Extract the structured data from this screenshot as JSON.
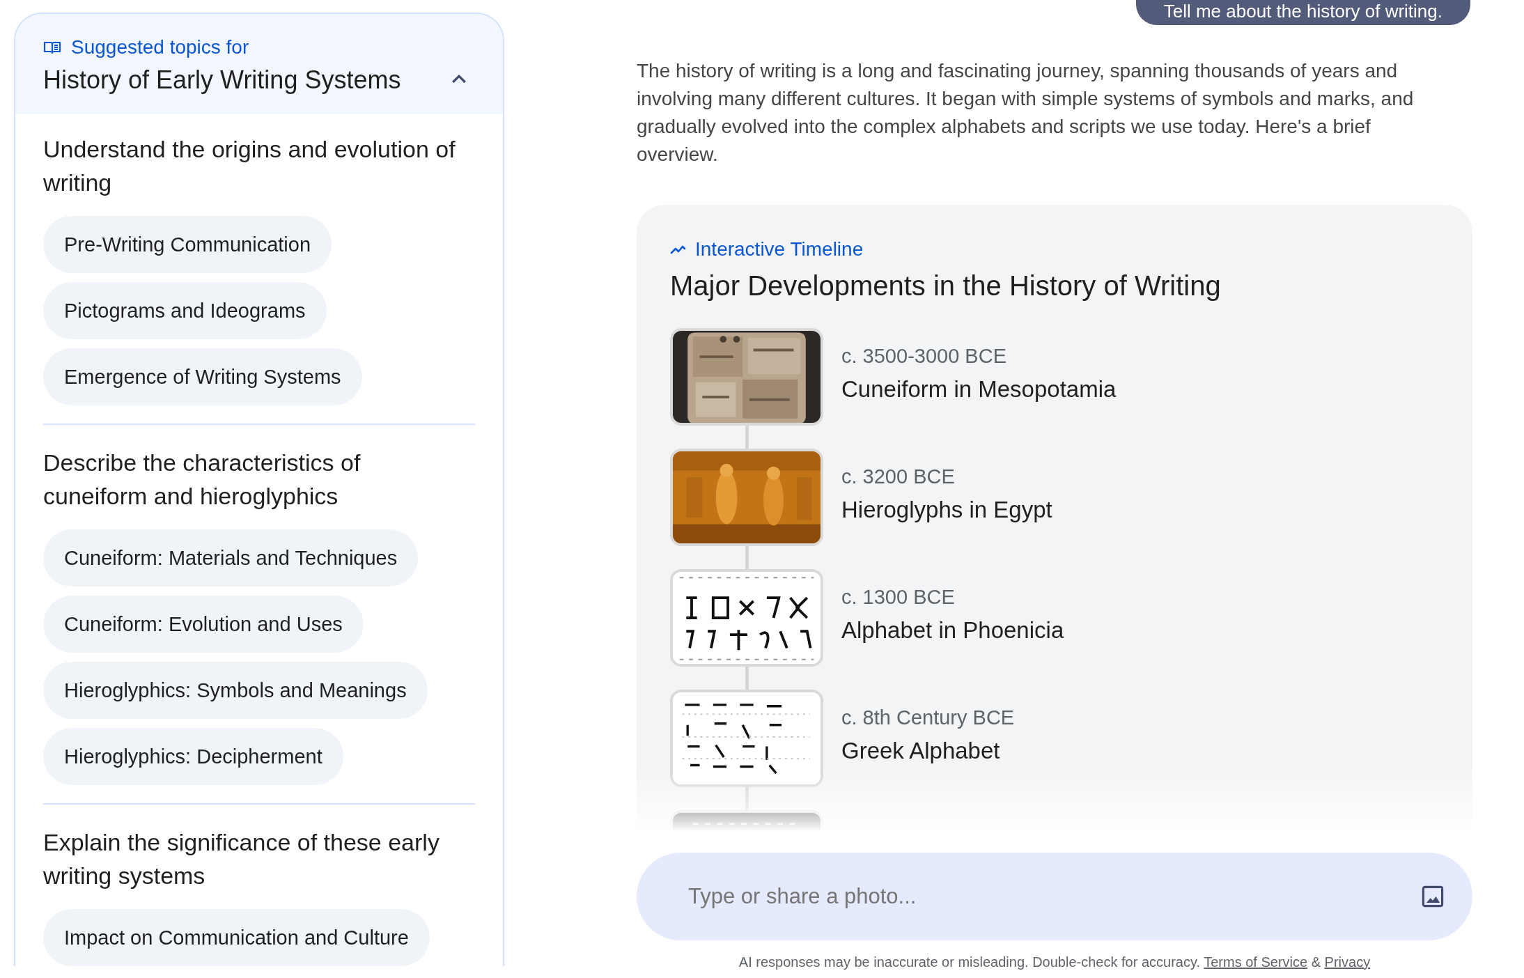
{
  "user_message": "Tell me about the history of writing.",
  "topics_panel": {
    "label": "Suggested topics for",
    "title": "History of Early Writing Systems",
    "expanded": true,
    "sections": [
      {
        "heading": "Understand the origins and evolution of writing",
        "topics": [
          "Pre-Writing Communication",
          "Pictograms and Ideograms",
          "Emergence of Writing Systems"
        ]
      },
      {
        "heading": "Describe the characteristics of cuneiform and hieroglyphics",
        "topics": [
          "Cuneiform: Materials and Techniques",
          "Cuneiform: Evolution and Uses",
          "Hieroglyphics: Symbols and Meanings",
          "Hieroglyphics: Decipherment"
        ]
      },
      {
        "heading": "Explain the significance of these early writing systems",
        "topics": [
          "Impact on Communication and Culture"
        ]
      }
    ]
  },
  "response": {
    "intro": "The history of writing is a long and fascinating journey, spanning thousands of years and involving many different cultures. It began with simple systems of symbols and marks, and gradually evolved into the complex alphabets and scripts we use today. Here's a brief overview.",
    "timeline": {
      "label": "Interactive Timeline",
      "title": "Major Developments in the History of Writing",
      "events": [
        {
          "date": "c. 3500-3000 BCE",
          "title": "Cuneiform in Mesopotamia",
          "image": {
            "kind": "picture"
          }
        },
        {
          "date": "c. 3200 BCE",
          "title": "Hieroglyphs in Egypt",
          "image": {
            "kind": "picture"
          }
        },
        {
          "date": "c. 1300 BCE",
          "title": "Alphabet in Phoenicia",
          "image": {
            "kind": "picture"
          }
        },
        {
          "date": "c. 8th Century BCE",
          "title": "Greek Alphabet",
          "image": {
            "kind": "picture"
          }
        },
        {
          "image": {
            "kind": "picture"
          }
        }
      ]
    }
  },
  "composer": {
    "placeholder": "Type or share a photo..."
  },
  "footer": {
    "disclaimer": "AI responses may be inaccurate or misleading. Double-check for accuracy.",
    "terms_link": "Terms of Service",
    "joiner": "&",
    "privacy_link": "Privacy"
  }
}
